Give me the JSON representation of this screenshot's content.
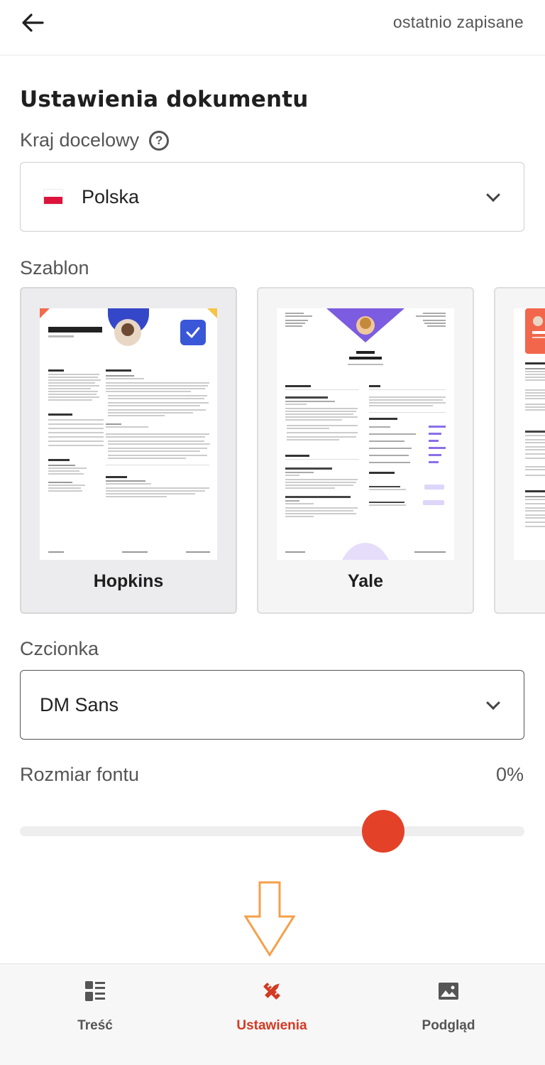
{
  "header": {
    "back_icon": "arrow-left-icon",
    "saved_status": "ostatnio zapisane"
  },
  "settings": {
    "title": "Ustawienia dokumentu",
    "country": {
      "label": "Kraj docelowy",
      "help_icon": "question-circle-icon",
      "flag_icon": "poland-flag-icon",
      "value": "Polska"
    },
    "template": {
      "label": "Szablon",
      "items": [
        {
          "name": "Hopkins",
          "selected": true
        },
        {
          "name": "Yale",
          "selected": false
        },
        {
          "name": "",
          "selected": false
        }
      ]
    },
    "font": {
      "label": "Czcionka",
      "value": "DM Sans"
    },
    "font_size": {
      "label": "Rozmiar fontu",
      "value": "0%",
      "slider_level": 0.74
    }
  },
  "nav": {
    "items": [
      {
        "label": "Treść",
        "icon": "content-layout-icon",
        "active": false
      },
      {
        "label": "Ustawienia",
        "icon": "design-tools-icon",
        "active": true
      },
      {
        "label": "Podgląd",
        "icon": "image-preview-icon",
        "active": false
      }
    ]
  },
  "colors": {
    "accent": "#e34228",
    "active_nav": "#d33a21",
    "hint_arrow": "#f5a04a"
  }
}
